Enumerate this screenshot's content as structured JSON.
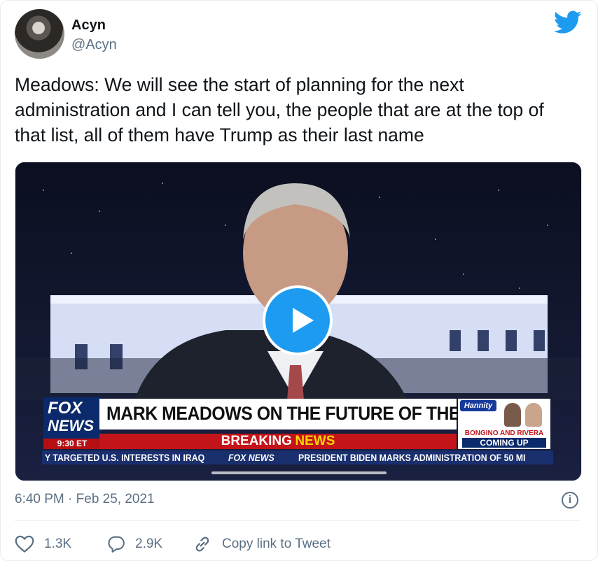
{
  "author": {
    "name": "Acyn",
    "handle": "@Acyn"
  },
  "tweet": {
    "text": "Meadows: We will see the start of planning for the next administration and I can tell you, the people that are at the top of that list, all of them have Trump as their last name",
    "timestamp": "6:40 PM · Feb 25, 2021"
  },
  "video": {
    "chyron": "MARK MEADOWS ON THE FUTURE OF THE GOP",
    "breaking": {
      "word1": "BREAKING",
      "word2": "NEWS"
    },
    "network": {
      "line1": "FOX",
      "line2": "NEWS",
      "time": "9:30 ET"
    },
    "promo": {
      "show": "Hannity",
      "subtitle": "BONGINO AND RIVERA",
      "coming": "COMING UP"
    },
    "ticker": {
      "left": "Y TARGETED U.S. INTERESTS IN IRAQ",
      "brand": "FOX NEWS",
      "right": "PRESIDENT BIDEN MARKS ADMINISTRATION OF 50 MI"
    }
  },
  "actions": {
    "likes": "1.3K",
    "replies": "2.9K",
    "copy_link": "Copy link to Tweet"
  },
  "colors": {
    "accent": "#1d9bf0",
    "text_secondary": "#5b7083",
    "chyron_red": "#c21419",
    "fox_blue": "#0b2a6b"
  },
  "icons": {
    "brand": "twitter-bird-icon",
    "play": "play-icon",
    "info": "info-icon",
    "like": "heart-icon",
    "reply": "reply-bubble-icon",
    "link": "link-icon"
  }
}
